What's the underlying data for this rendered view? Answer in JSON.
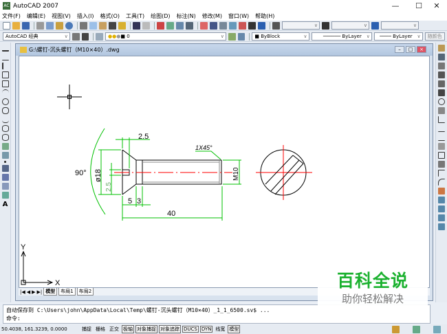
{
  "app": {
    "title": "AutoCAD 2007",
    "logo_text": "AC"
  },
  "window_controls": {
    "minimize": "—",
    "maximize": "☐",
    "close": "✕"
  },
  "menu": [
    "文件(F)",
    "编辑(E)",
    "视图(V)",
    "插入(I)",
    "格式(O)",
    "工具(T)",
    "绘图(D)",
    "标注(N)",
    "修改(M)",
    "窗口(W)",
    "帮助(H)"
  ],
  "toolbar2": {
    "workspace": "AutoCAD 经典",
    "layer": "0",
    "color": "ByBlock",
    "linetype": "ByLayer",
    "lineweight": "ByLayer",
    "plotstyle": "随颜色"
  },
  "document": {
    "title": "G:\\螺钉-沉头螺钉（M10×40）.dwg"
  },
  "drawing": {
    "dims": {
      "head_thickness": "2.5",
      "angle": "90°",
      "head_dia": "ø18",
      "slot": "2.5",
      "seg1": "5",
      "seg2": "3",
      "length": "40",
      "thread": "M10",
      "chamfer": "1X45°"
    },
    "ucs": {
      "x": "X",
      "y": "Y"
    },
    "colors": {
      "geometry": "#000000",
      "dimension": "#00c000",
      "centerline": "#ff0000"
    }
  },
  "tabs": {
    "nav": [
      "|◀",
      "◀",
      "▶",
      "▶|"
    ],
    "items": [
      "模型",
      "布局1",
      "布局2"
    ],
    "active": 0
  },
  "command": {
    "line1": "自动保存到 C:\\Users\\john\\AppData\\Local\\Temp\\螺钉-沉头螺钉（M10×40）_1_1_6500.sv$ ...",
    "line2": "命令:"
  },
  "status": {
    "coords": "50.4038,  161.3239,  0.0000",
    "buttons": [
      {
        "label": "捕捉",
        "on": false
      },
      {
        "label": "栅格",
        "on": false
      },
      {
        "label": "正交",
        "on": false
      },
      {
        "label": "极轴",
        "on": true
      },
      {
        "label": "对象捕捉",
        "on": true
      },
      {
        "label": "对象追踪",
        "on": true
      },
      {
        "label": "DUCS",
        "on": true
      },
      {
        "label": "DYN",
        "on": true
      },
      {
        "label": "线宽",
        "on": false
      },
      {
        "label": "模型",
        "on": true
      }
    ]
  },
  "watermark": {
    "title": "百科全说",
    "subtitle": "助你轻松解决"
  }
}
